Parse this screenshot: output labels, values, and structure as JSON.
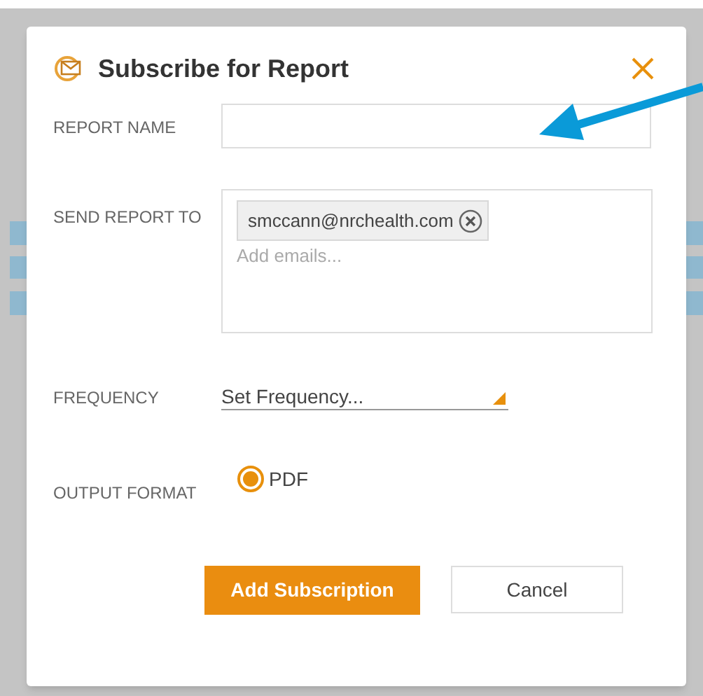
{
  "dialog": {
    "title": "Subscribe for Report",
    "fields": [
      {
        "kind": "text",
        "label": "REPORT NAME"
      },
      {
        "kind": "emails",
        "label": "SEND REPORT TO",
        "emails": [
          "smccann@nrchealth.com"
        ],
        "placeholder": "Add emails..."
      },
      {
        "kind": "select",
        "label": "FREQUENCY",
        "value": "Set Frequency..."
      },
      {
        "kind": "radio",
        "label": "OUTPUT FORMAT",
        "options": [
          {
            "label": "PDF",
            "selected": true
          }
        ]
      }
    ],
    "buttons": [
      {
        "kind": "primary",
        "label": "Add Subscription"
      },
      {
        "kind": "secondary",
        "label": "Cancel"
      }
    ]
  }
}
